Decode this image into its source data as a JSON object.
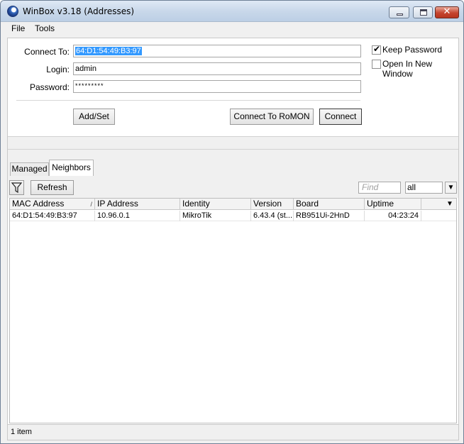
{
  "window": {
    "title": "WinBox v3.18 (Addresses)"
  },
  "menu": {
    "items": [
      "File",
      "Tools"
    ]
  },
  "connect": {
    "connect_to_label": "Connect To:",
    "connect_to_value": "64:D1:54:49:B3:97",
    "login_label": "Login:",
    "login_value": "admin",
    "password_label": "Password:",
    "password_value": "*********",
    "keep_password_label": "Keep Password",
    "keep_password_checked": true,
    "open_new_window_label": "Open In New Window",
    "open_new_window_checked": false,
    "add_set_label": "Add/Set",
    "connect_romon_label": "Connect To RoMON",
    "connect_label": "Connect"
  },
  "tabs": [
    {
      "label": "Managed",
      "active": false
    },
    {
      "label": "Neighbors",
      "active": true
    }
  ],
  "toolbar": {
    "refresh_label": "Refresh",
    "find_placeholder": "Find",
    "filter_value": "all"
  },
  "table": {
    "columns": [
      "MAC Address",
      "IP Address",
      "Identity",
      "Version",
      "Board",
      "Uptime"
    ],
    "rows": [
      [
        "64:D1:54:49:B3:97",
        "10.96.0.1",
        "MikroTik",
        "6.43.4 (st...",
        "RB951Ui-2HnD",
        "04:23:24"
      ]
    ]
  },
  "status": {
    "count": "1 item"
  },
  "colors": {
    "selection": "#3399ff",
    "close_button": "#c4442e"
  }
}
